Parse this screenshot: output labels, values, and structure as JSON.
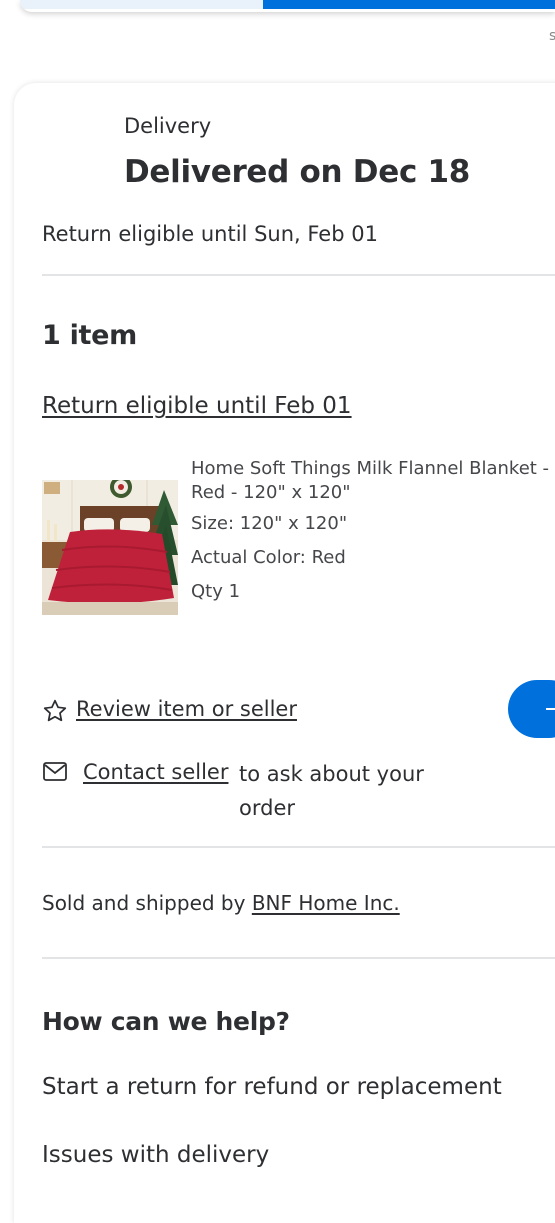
{
  "header": {
    "edge_glyph": "s"
  },
  "delivery": {
    "label": "Delivery",
    "status_title": "Delivered on Dec 18",
    "return_eligible_text": "Return eligible until Sun, Feb 01"
  },
  "items": {
    "count_label": "1 item",
    "return_link": "Return eligible until Feb 01",
    "product": {
      "title": "Home Soft Things Milk Flannel Blanket - Red - 120\" x 120\"",
      "size": "Size: 120\" x 120\"",
      "color": "Actual Color: Red",
      "qty": "Qty 1",
      "image_icon": "red-blanket-on-bed-photo"
    }
  },
  "actions": {
    "review_link": "Review item or seller",
    "review_icon": "star-outline-icon",
    "contact_link": "Contact seller",
    "contact_suffix": "to ask about your order",
    "contact_icon": "envelope-icon"
  },
  "seller": {
    "prefix": "Sold and shipped by ",
    "name": "BNF Home Inc."
  },
  "help": {
    "title": "How can we help?",
    "options": [
      "Start a return for refund or replacement",
      "Issues with delivery"
    ]
  },
  "colors": {
    "accent": "#0071dc",
    "text": "#2e2f32",
    "divider": "#e3e4e5"
  }
}
